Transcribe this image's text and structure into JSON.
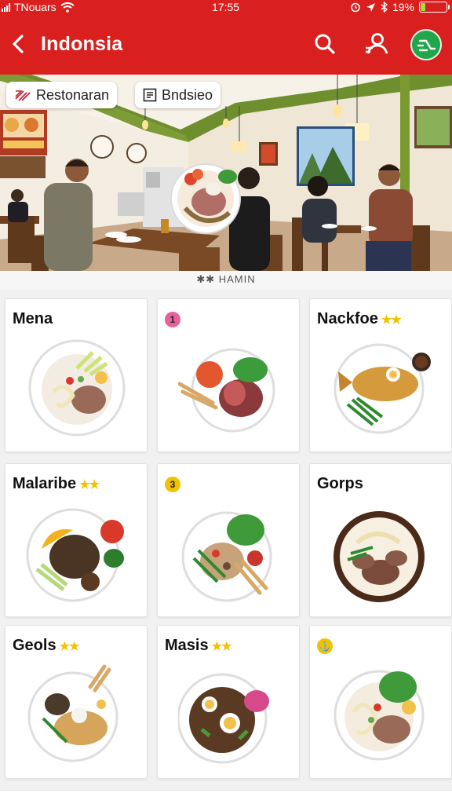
{
  "status_bar": {
    "carrier": "TNouars",
    "time": "17:55",
    "battery": "19%",
    "battery_level": 0.19
  },
  "header": {
    "title": "Indonsia",
    "icons": [
      "back-arrow-icon",
      "search-icon",
      "user-location-icon",
      "map-route-icon"
    ],
    "accent": "#d9201f",
    "map_button_color": "#22a64a"
  },
  "hero": {
    "chips": [
      {
        "label": "Restonaran",
        "icon": "restaurant-icon"
      },
      {
        "label": "Bndsieo",
        "icon": "menu-icon"
      }
    ]
  },
  "divider_text": "✱✱ HAMIN",
  "dishes": [
    {
      "name": "Mena",
      "stars": "",
      "badge": ""
    },
    {
      "name": "",
      "stars": "",
      "badge": "1",
      "badge_color": "#e6609a"
    },
    {
      "name": "Nackfoe",
      "stars": "★★",
      "badge": ""
    },
    {
      "name": "Malaribe",
      "stars": "★★",
      "badge": ""
    },
    {
      "name": "",
      "stars": "",
      "badge": "3",
      "badge_color": "#f2c200"
    },
    {
      "name": "Gorps",
      "stars": "",
      "badge": ""
    },
    {
      "name": "Geols",
      "stars": "★★",
      "badge": ""
    },
    {
      "name": "Masis",
      "stars": "★★",
      "badge": ""
    },
    {
      "name": "",
      "stars": "",
      "badge": "⚓",
      "badge_color": "#f2c200"
    }
  ]
}
